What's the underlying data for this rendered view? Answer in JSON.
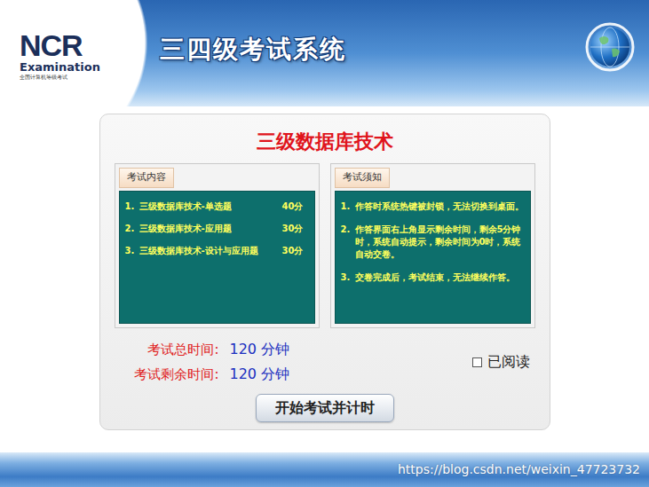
{
  "header": {
    "logo": {
      "mark": "NCR",
      "subtitle": "Examination",
      "caption": "全国计算机等级考试"
    },
    "title": "三四级考试系统"
  },
  "exam": {
    "title": "三级数据库技术",
    "content": {
      "label": "考试内容",
      "items": [
        {
          "number": "1.",
          "name": "三级数据库技术-单选题",
          "score": "40分"
        },
        {
          "number": "2.",
          "name": "三级数据库技术-应用题",
          "score": "30分"
        },
        {
          "number": "3.",
          "name": "三级数据库技术-设计与应用题",
          "score": "30分"
        }
      ]
    },
    "notice": {
      "label": "考试须知",
      "items": [
        {
          "number": "1.",
          "text": "作答时系统热键被封锁，无法切换到桌面。"
        },
        {
          "number": "2.",
          "text": "作答界面右上角显示剩余时间，剩余5分钟时，系统自动提示，剩余时间为0时，系统自动交卷。"
        },
        {
          "number": "3.",
          "text": "交卷完成后，考试结束，无法继续作答。"
        }
      ]
    },
    "times": [
      {
        "label": "考试总时间:",
        "value": "120 分钟"
      },
      {
        "label": "考试剩余时间:",
        "value": "120 分钟"
      }
    ],
    "read": {
      "label": "已阅读",
      "checked": false
    },
    "start_button": "开始考试并计时"
  },
  "watermark": "https://blog.csdn.net/weixin_47723732"
}
